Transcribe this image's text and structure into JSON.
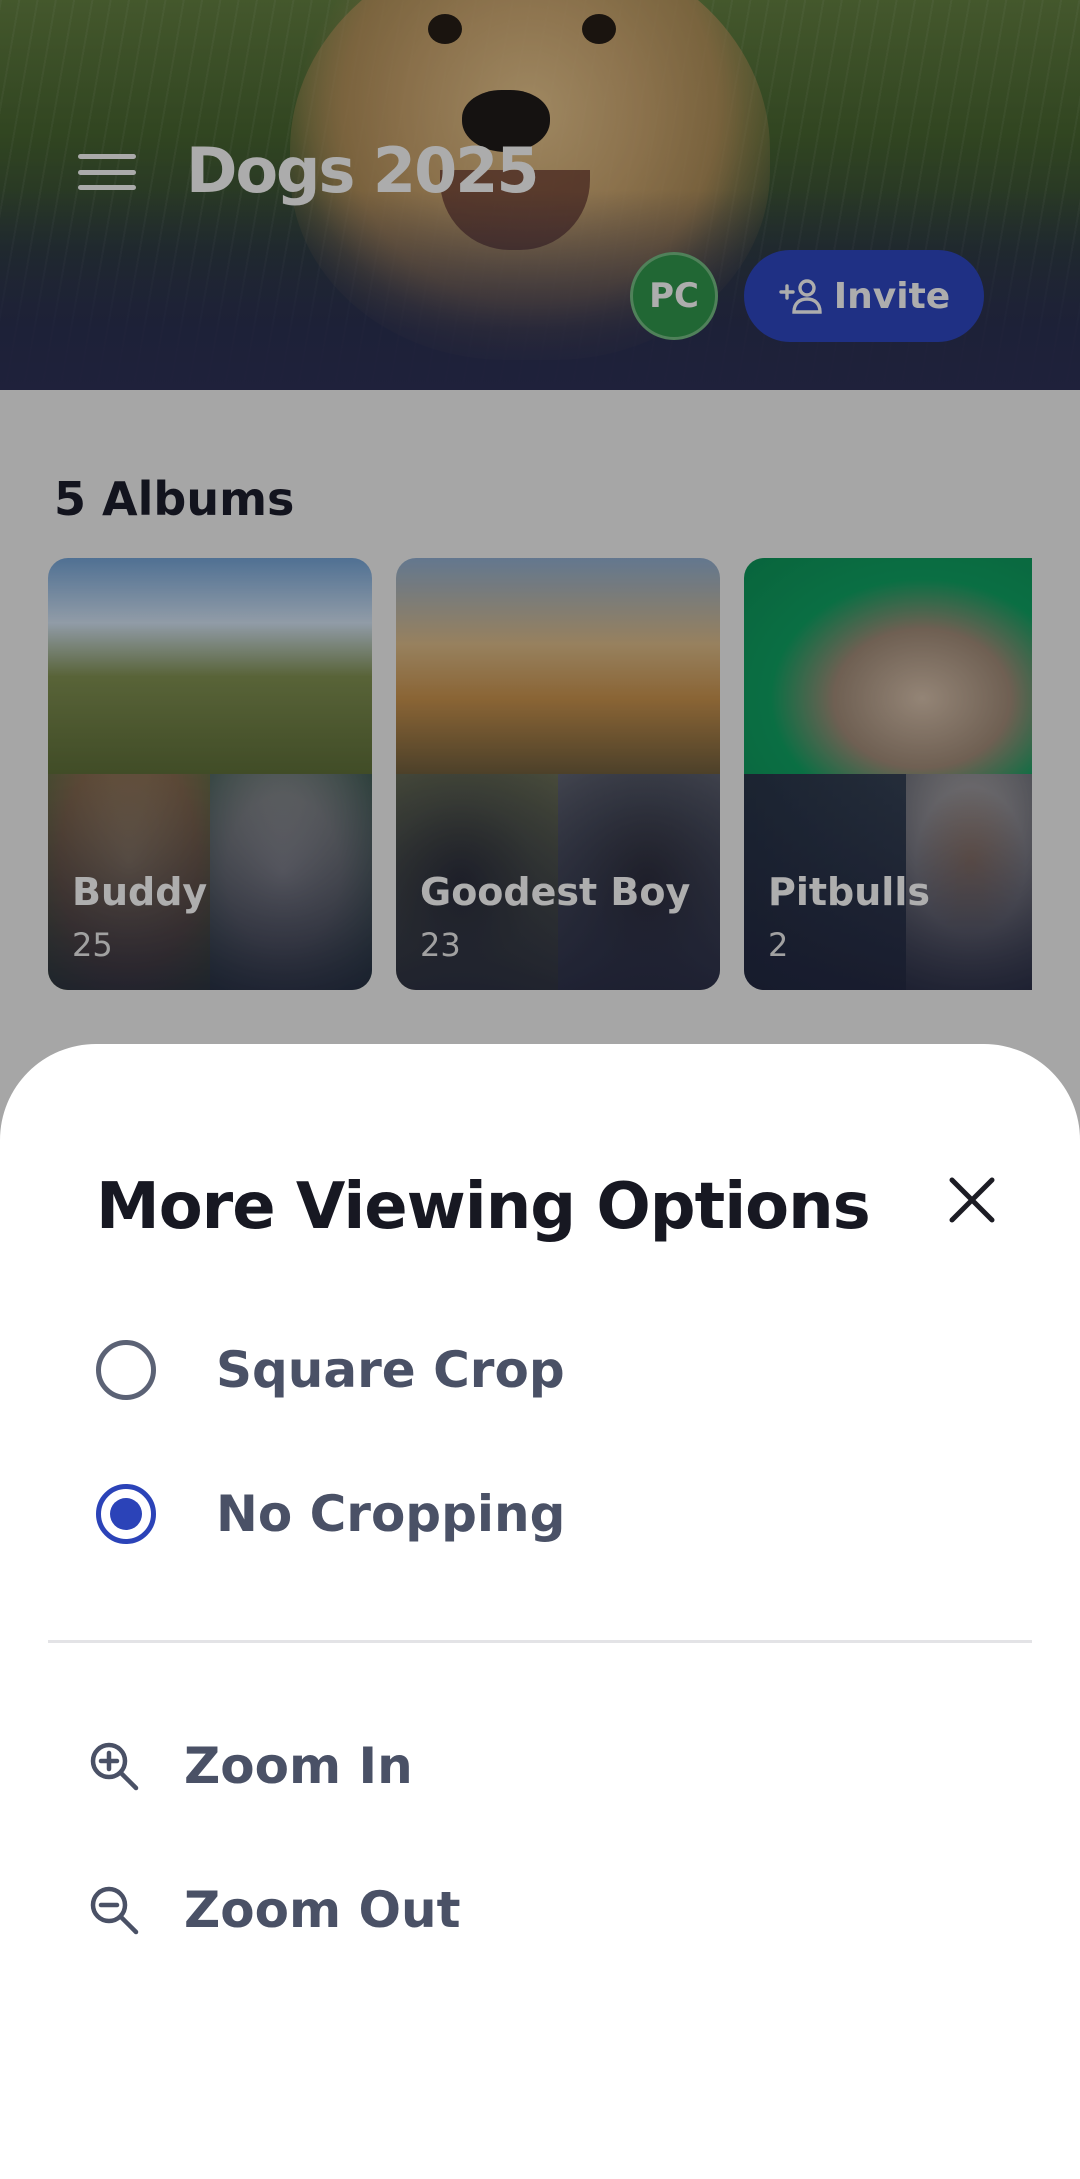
{
  "header": {
    "title": "Dogs 2025",
    "avatar_initials": "PC",
    "invite_label": "Invite"
  },
  "albums": {
    "heading": "5 Albums",
    "items": [
      {
        "name": "Buddy",
        "count": "25"
      },
      {
        "name": "Goodest Boy",
        "count": "23"
      },
      {
        "name": "Pitbulls",
        "count": "2"
      }
    ]
  },
  "sheet": {
    "title": "More Viewing Options",
    "options": [
      {
        "label": "Square Crop",
        "selected": false
      },
      {
        "label": "No Cropping",
        "selected": true
      }
    ],
    "zoom_in_label": "Zoom In",
    "zoom_out_label": "Zoom Out"
  },
  "colors": {
    "accent": "#2b43b8",
    "avatar_bg": "#2f8f48",
    "sheet_bg": "#ffffff"
  },
  "icons": [
    "menu-icon",
    "add-person-icon",
    "close-icon",
    "zoom-in-icon",
    "zoom-out-icon"
  ]
}
